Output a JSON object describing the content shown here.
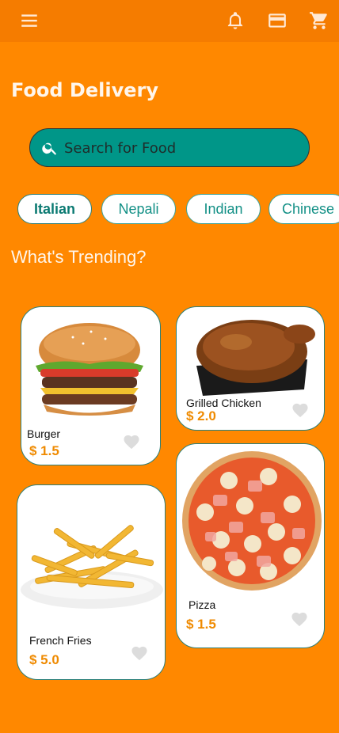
{
  "app": {
    "title": "Food Delivery",
    "section_title": "What's Trending?"
  },
  "appbar": {
    "menu_icon": "menu-icon",
    "icons": [
      "bell-icon",
      "card-icon",
      "cart-icon"
    ]
  },
  "search": {
    "placeholder": "Search for Food",
    "icon": "search-icon"
  },
  "categories": [
    {
      "label": "Italian",
      "active": true
    },
    {
      "label": "Nepali",
      "active": false
    },
    {
      "label": "Indian",
      "active": false
    },
    {
      "label": "Chinese",
      "active": false
    }
  ],
  "items": [
    {
      "name": "Burger",
      "price": "$ 1.5",
      "image": "burger-image"
    },
    {
      "name": "Grilled Chicken",
      "price": "$ 2.0",
      "image": "chicken-image"
    },
    {
      "name": "French Fries",
      "price": "$ 5.0",
      "image": "fries-image"
    },
    {
      "name": "Pizza",
      "price": "$ 1.5",
      "image": "pizza-image"
    }
  ],
  "colors": {
    "background": "#FF8800",
    "appbar": "#F57C00",
    "search": "#009688",
    "accent": "#EF8A00",
    "chip_text": "#139086"
  }
}
